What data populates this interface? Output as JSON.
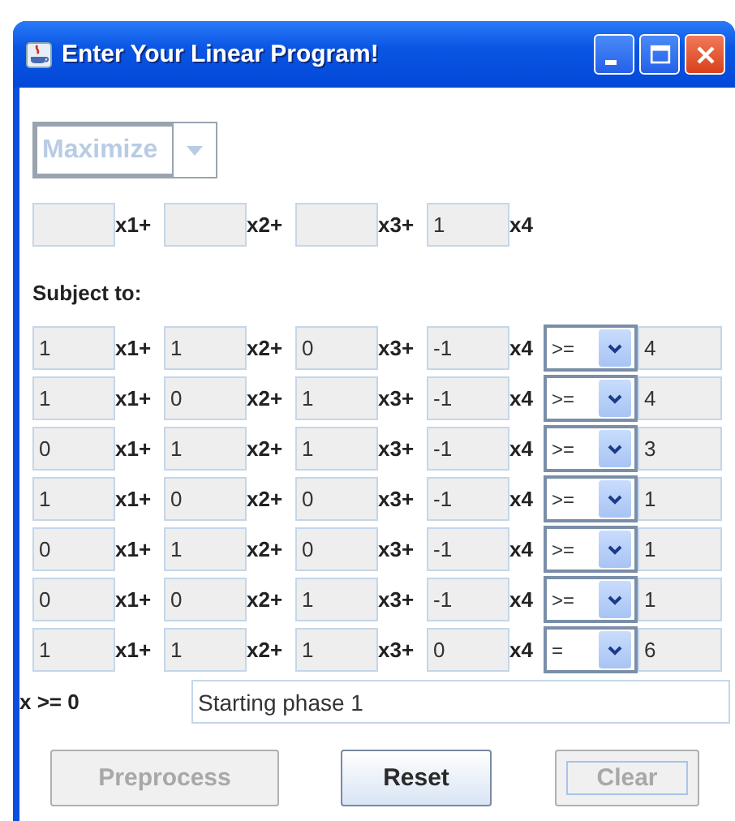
{
  "window": {
    "title": "Enter Your Linear Program!"
  },
  "objective_sense": {
    "value": "Maximize",
    "disabled": true
  },
  "objective": {
    "coefficients": [
      {
        "kind": "empty"
      },
      {
        "kind": "empty"
      },
      {
        "kind": "empty"
      },
      {
        "kind": "filled",
        "value": "1"
      }
    ],
    "variables": [
      "x1+",
      "x2+",
      "x3+",
      "x4"
    ]
  },
  "subject_to_label": "Subject to:",
  "constraints": [
    {
      "coefficients": [
        "1",
        "1",
        "0",
        "-1"
      ],
      "variables": [
        "x1+",
        "x2+",
        "x3+",
        "x4"
      ],
      "relation": ">=",
      "rhs": "4"
    },
    {
      "coefficients": [
        "1",
        "0",
        "1",
        "-1"
      ],
      "variables": [
        "x1+",
        "x2+",
        "x3+",
        "x4"
      ],
      "relation": ">=",
      "rhs": "4"
    },
    {
      "coefficients": [
        "0",
        "1",
        "1",
        "-1"
      ],
      "variables": [
        "x1+",
        "x2+",
        "x3+",
        "x4"
      ],
      "relation": ">=",
      "rhs": "3"
    },
    {
      "coefficients": [
        "1",
        "0",
        "0",
        "-1"
      ],
      "variables": [
        "x1+",
        "x2+",
        "x3+",
        "x4"
      ],
      "relation": ">=",
      "rhs": "1"
    },
    {
      "coefficients": [
        "0",
        "1",
        "0",
        "-1"
      ],
      "variables": [
        "x1+",
        "x2+",
        "x3+",
        "x4"
      ],
      "relation": ">=",
      "rhs": "1"
    },
    {
      "coefficients": [
        "0",
        "0",
        "1",
        "-1"
      ],
      "variables": [
        "x1+",
        "x2+",
        "x3+",
        "x4"
      ],
      "relation": ">=",
      "rhs": "1"
    },
    {
      "coefficients": [
        "1",
        "1",
        "1",
        "0"
      ],
      "variables": [
        "x1+",
        "x2+",
        "x3+",
        "x4"
      ],
      "relation": "=",
      "rhs": "6"
    }
  ],
  "nonnegativity_label": "x >= 0",
  "status": "Starting phase 1",
  "buttons": [
    {
      "label": "Preprocess",
      "disabled": true,
      "focused": false
    },
    {
      "label": "Reset",
      "disabled": false,
      "focused": false
    },
    {
      "label": "Clear",
      "disabled": true,
      "focused": true
    }
  ]
}
